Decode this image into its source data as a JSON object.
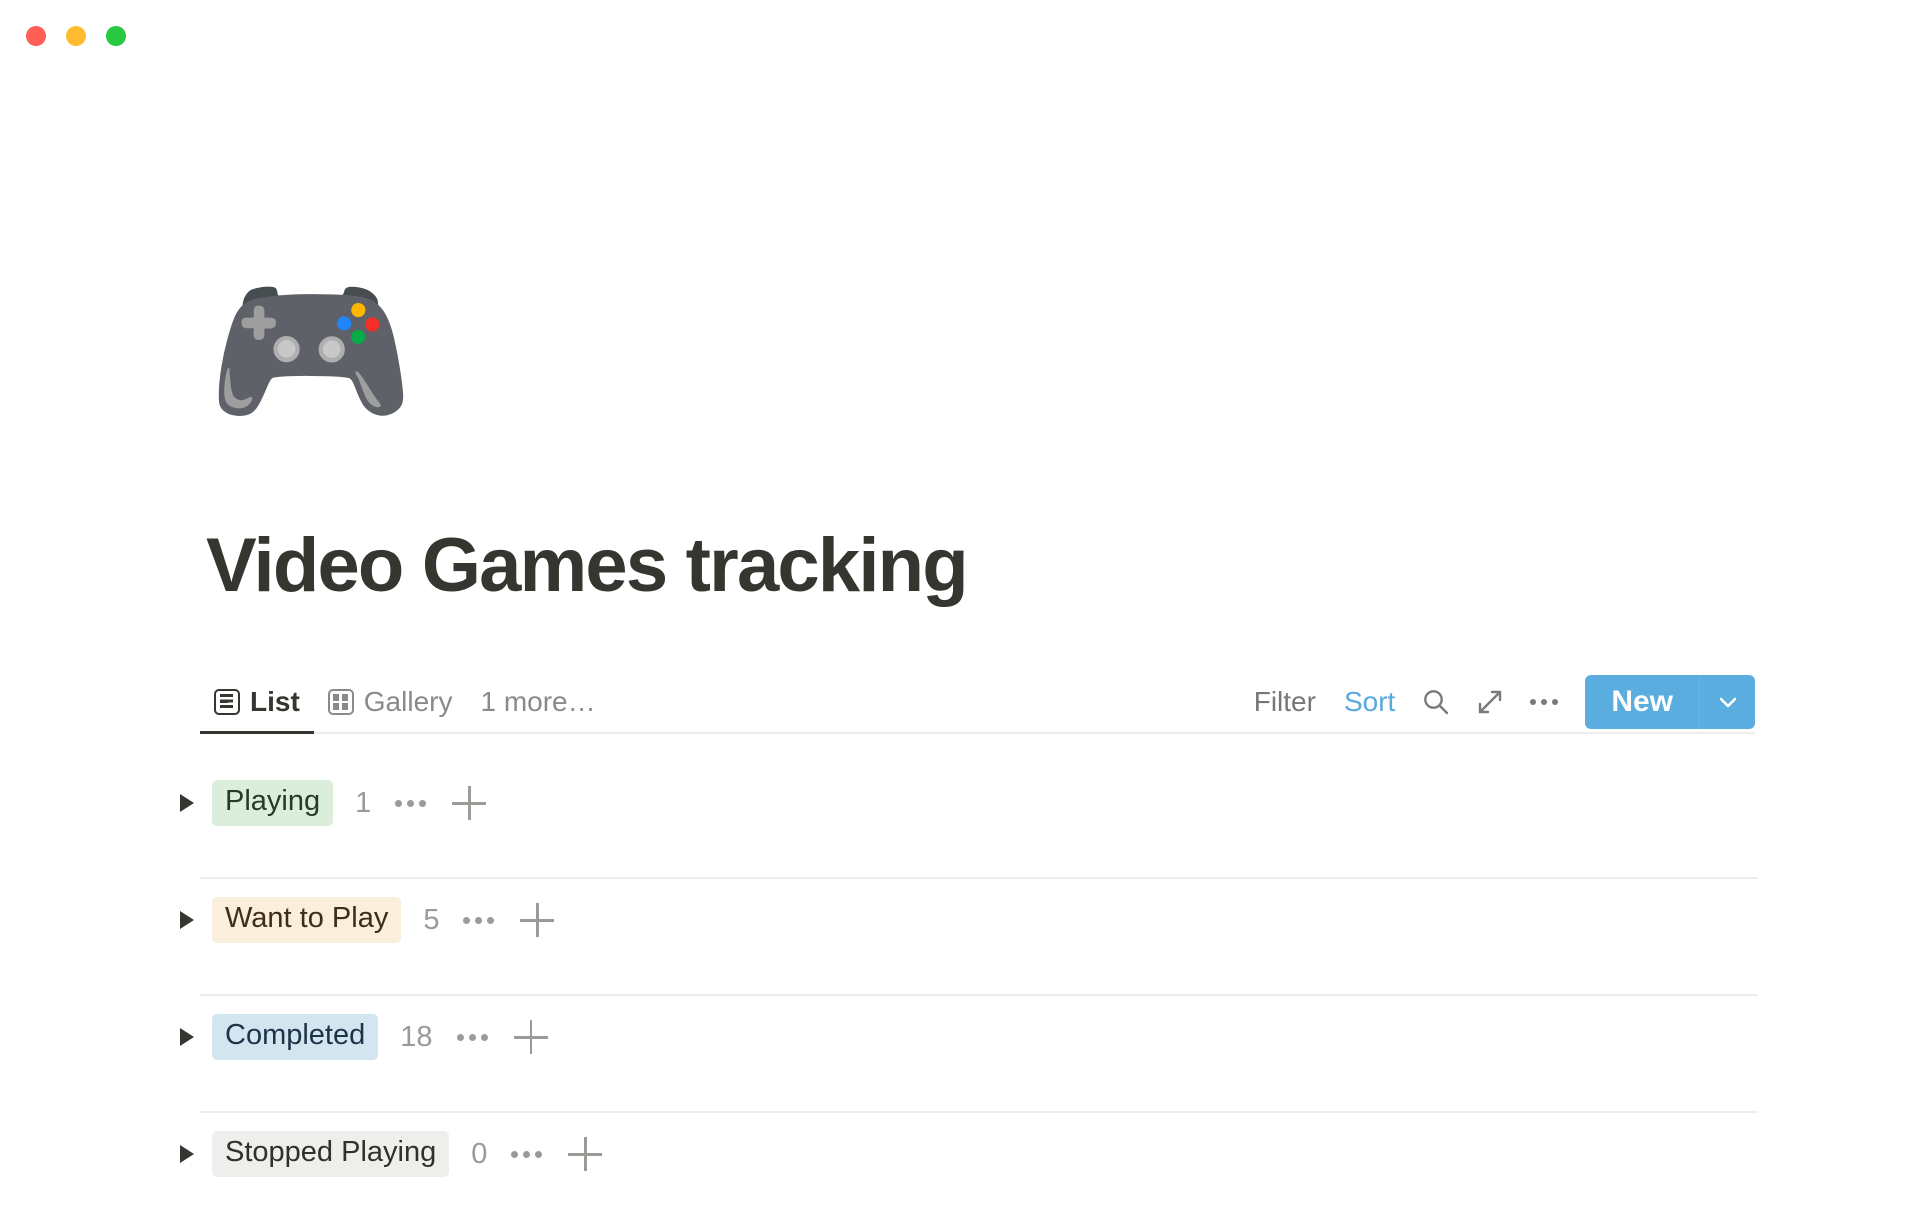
{
  "window": {
    "traffic_lights": [
      {
        "name": "close",
        "color": "#ff5f57"
      },
      {
        "name": "minimize",
        "color": "#febc2e"
      },
      {
        "name": "maximize",
        "color": "#28c840"
      }
    ]
  },
  "page": {
    "icon": "🎮",
    "icon_name": "video-game-controller-emoji",
    "title": "Video Games tracking"
  },
  "views": {
    "tabs": [
      {
        "label": "List",
        "icon": "list-view-icon",
        "active": true
      },
      {
        "label": "Gallery",
        "icon": "gallery-view-icon",
        "active": false
      }
    ],
    "more_label": "1 more…"
  },
  "toolbar": {
    "filter_label": "Filter",
    "sort_label": "Sort",
    "search_icon": "search-icon",
    "expand_icon": "expand-diagonal-icon",
    "more_icon": "ellipsis-icon",
    "new_label": "New",
    "new_caret_icon": "chevron-down-icon",
    "accent_color": "#5aadde",
    "sort_color": "#5aa9de",
    "filter_color": "#787774"
  },
  "groups": [
    {
      "label": "Playing",
      "count": "1",
      "chip_bg": "#dbeddb",
      "chip_fg": "#27392b",
      "collapsed": true
    },
    {
      "label": "Want to Play",
      "count": "5",
      "chip_bg": "#faeedc",
      "chip_fg": "#402c1b",
      "collapsed": true
    },
    {
      "label": "Completed",
      "count": "18",
      "chip_bg": "#d3e5ef",
      "chip_fg": "#1d3448",
      "collapsed": true
    },
    {
      "label": "Stopped Playing",
      "count": "0",
      "chip_bg": "#eeeeec",
      "chip_fg": "#32302c",
      "collapsed": true
    }
  ]
}
